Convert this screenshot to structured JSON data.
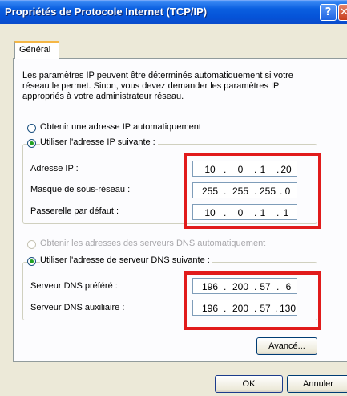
{
  "window": {
    "title": "Propriétés de Protocole Internet (TCP/IP)",
    "help_glyph": "?",
    "close_glyph": "✕"
  },
  "tabs": {
    "general": "Général"
  },
  "intro": {
    "line1": "Les paramètres IP peuvent être déterminés automatiquement si votre",
    "line2": "réseau le permet. Sinon, vous devez demander les paramètres IP",
    "line3": "appropriés à votre administrateur réseau."
  },
  "ip_mode": {
    "auto_label": "Obtenir une adresse IP automatiquement",
    "manual_label": "Utiliser l'adresse IP suivante :",
    "selected": "manual"
  },
  "ip_fields": {
    "address": {
      "label": "Adresse IP :",
      "octets": [
        "10",
        "0",
        "1",
        "20"
      ]
    },
    "mask": {
      "label": "Masque de sous-réseau :",
      "octets": [
        "255",
        "255",
        "255",
        "0"
      ]
    },
    "gateway": {
      "label": "Passerelle par défaut :",
      "octets": [
        "10",
        "0",
        "1",
        "1"
      ]
    }
  },
  "dns_mode": {
    "auto_label": "Obtenir les adresses des serveurs DNS automatiquement",
    "manual_label": "Utiliser l'adresse de serveur DNS suivante :",
    "selected": "manual"
  },
  "dns_fields": {
    "preferred": {
      "label": "Serveur DNS préféré :",
      "octets": [
        "196",
        "200",
        "57",
        "6"
      ]
    },
    "alternate": {
      "label": "Serveur DNS auxiliaire :",
      "octets": [
        "196",
        "200",
        "57",
        "130"
      ]
    }
  },
  "buttons": {
    "advanced": "Avancé...",
    "ok": "OK",
    "cancel": "Annuler"
  },
  "colors": {
    "highlight_border": "#e11b1b",
    "titlebar": "#0553d8",
    "radio_selected": "#21a121"
  }
}
